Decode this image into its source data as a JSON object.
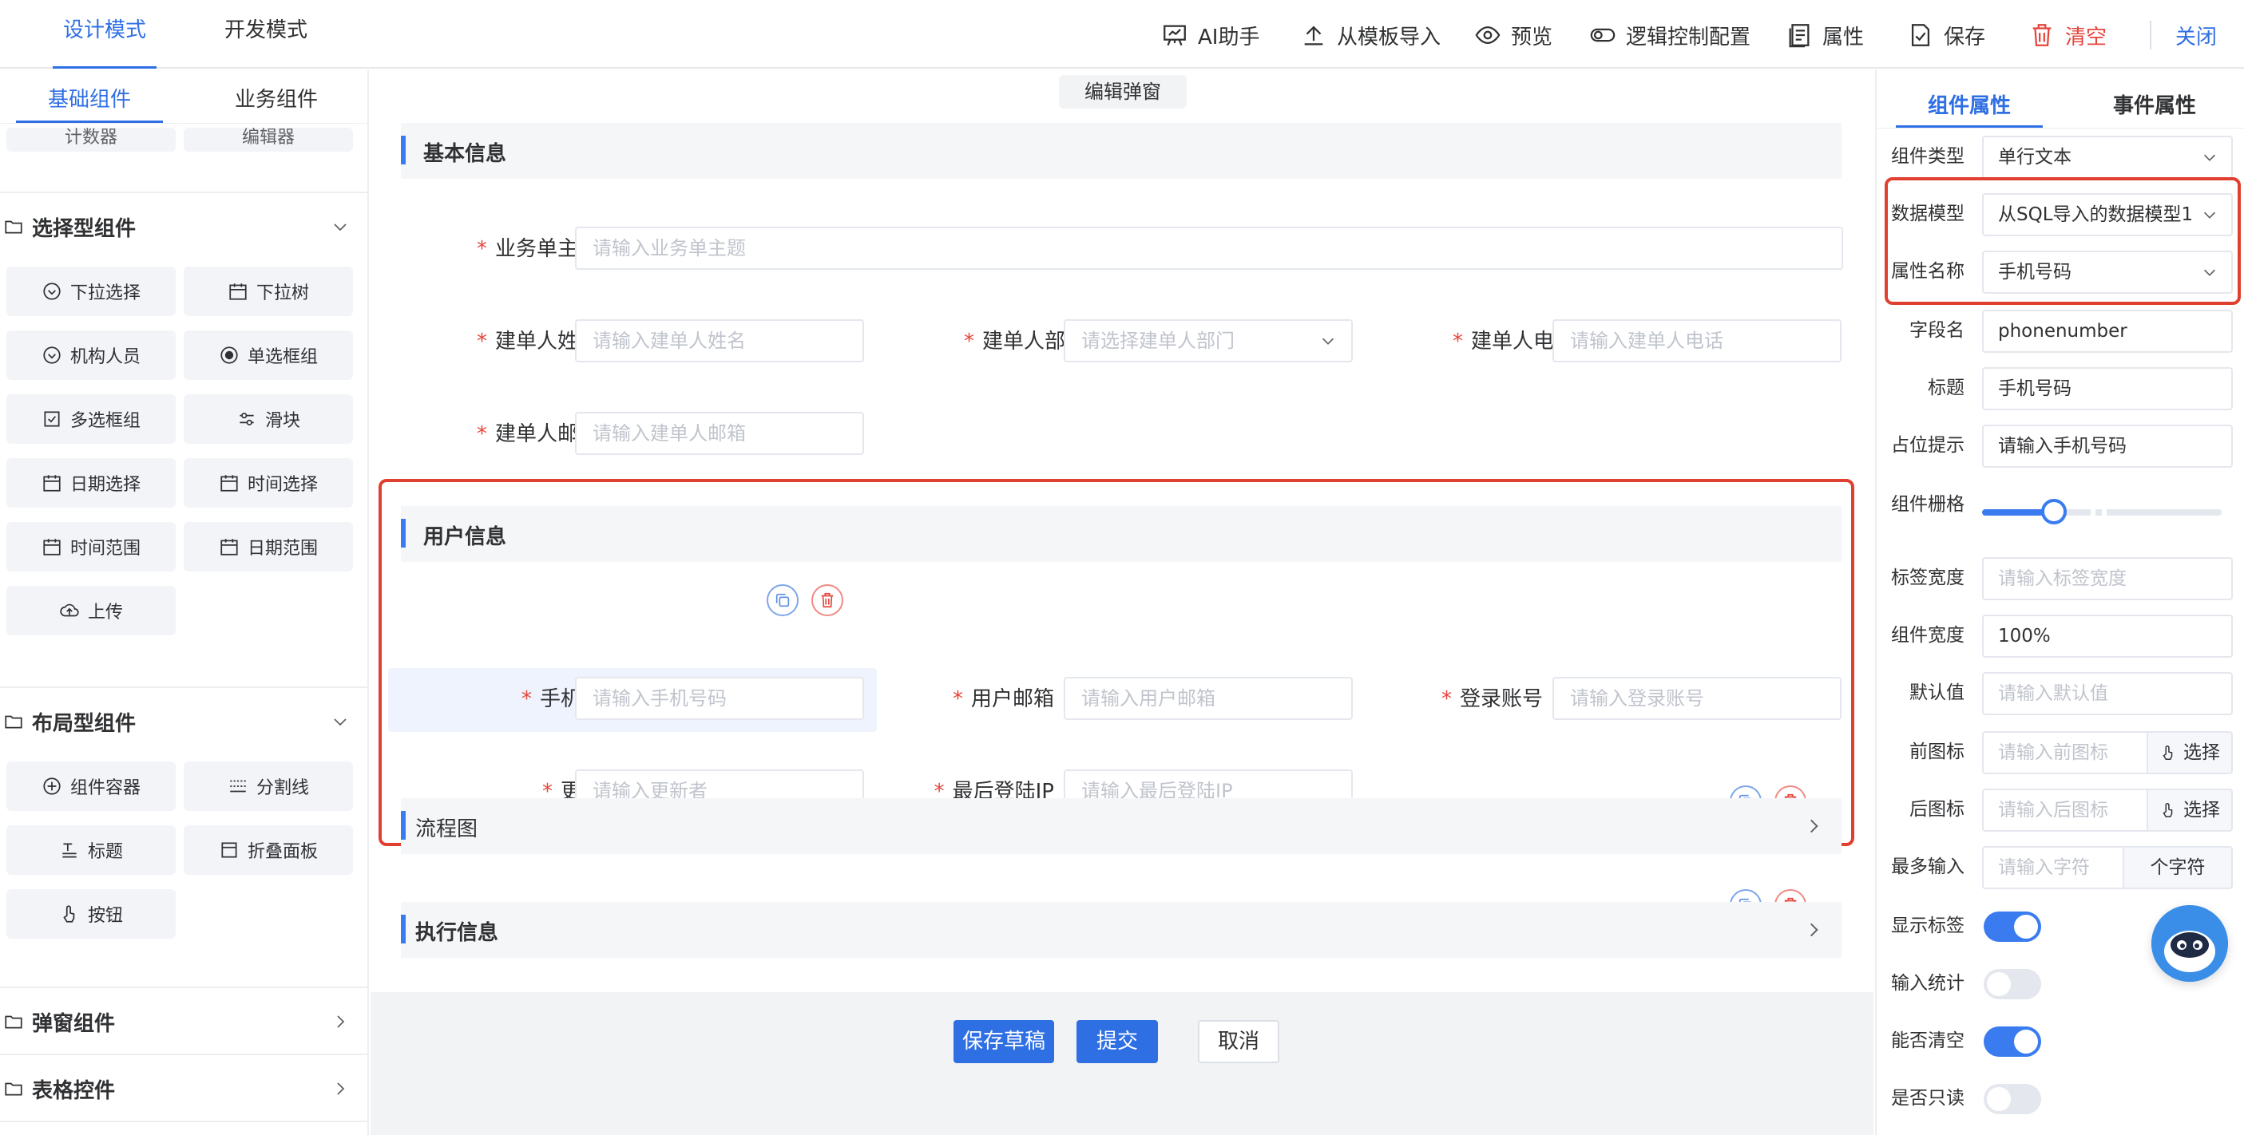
{
  "header": {
    "modes": [
      "设计模式",
      "开发模式"
    ],
    "tools": {
      "ai": "AI助手",
      "import": "从模板导入",
      "preview": "预览",
      "logic": "逻辑控制配置",
      "props": "属性",
      "save": "保存",
      "clear": "清空",
      "close": "关闭"
    }
  },
  "left": {
    "tabs": [
      "基础组件",
      "业务组件"
    ],
    "partial": [
      "计数器",
      "编辑器"
    ],
    "groups": {
      "select": "选择型组件",
      "layout": "布局型组件",
      "popup": "弹窗组件",
      "table": "表格控件"
    },
    "select_items": [
      "下拉选择",
      "下拉树",
      "机构人员",
      "单选框组",
      "多选框组",
      "滑块",
      "日期选择",
      "时间选择",
      "时间范围",
      "日期范围",
      "上传"
    ],
    "layout_items": [
      "组件容器",
      "分割线",
      "标题",
      "折叠面板",
      "按钮"
    ]
  },
  "canvas": {
    "dialog_title": "编辑弹窗",
    "sections": {
      "basic": "基本信息",
      "user": "用户信息",
      "flow": "流程图",
      "exec": "执行信息"
    },
    "basic_fields": {
      "subject": {
        "label": "业务单主题",
        "placeholder": "请输入业务单主题"
      },
      "creator_name": {
        "label": "建单人姓名",
        "placeholder": "请输入建单人姓名"
      },
      "creator_dept": {
        "label": "建单人部门",
        "placeholder": "请选择建单人部门"
      },
      "creator_phone": {
        "label": "建单人电话",
        "placeholder": "请输入建单人电话"
      },
      "creator_email": {
        "label": "建单人邮箱",
        "placeholder": "请输入建单人邮箱"
      }
    },
    "user_fields": {
      "phone": {
        "label": "手机号码",
        "placeholder": "请输入手机号码"
      },
      "email": {
        "label": "用户邮箱",
        "placeholder": "请输入用户邮箱"
      },
      "account": {
        "label": "登录账号",
        "placeholder": "请输入登录账号"
      },
      "updater": {
        "label": "更新者",
        "placeholder": "请输入更新者"
      },
      "last_ip": {
        "label": "最后登陆IP",
        "placeholder": "请输入最后登陆IP"
      }
    },
    "footer": {
      "draft": "保存草稿",
      "submit": "提交",
      "cancel": "取消"
    }
  },
  "right": {
    "tabs": [
      "组件属性",
      "事件属性"
    ],
    "props": {
      "type": {
        "label": "组件类型",
        "value": "单行文本"
      },
      "model": {
        "label": "数据模型",
        "value": "从SQL导入的数据模型1"
      },
      "attr": {
        "label": "属性名称",
        "value": "手机号码"
      },
      "field": {
        "label": "字段名",
        "value": "phonenumber"
      },
      "title": {
        "label": "标题",
        "value": "手机号码"
      },
      "placeholder": {
        "label": "占位提示",
        "value": "请输入手机号码"
      },
      "grid": {
        "label": "组件栅格",
        "value": 0.3
      },
      "label_width": {
        "label": "标签宽度",
        "placeholder": "请输入标签宽度"
      },
      "width": {
        "label": "组件宽度",
        "value": "100%"
      },
      "default": {
        "label": "默认值",
        "placeholder": "请输入默认值"
      },
      "prefix_icon": {
        "label": "前图标",
        "placeholder": "请输入前图标",
        "button": "选择"
      },
      "suffix_icon": {
        "label": "后图标",
        "placeholder": "请输入后图标",
        "button": "选择"
      },
      "max_input": {
        "label": "最多输入",
        "placeholder": "请输入字符",
        "unit": "个字符"
      },
      "show_label": {
        "label": "显示标签",
        "on": true
      },
      "input_count": {
        "label": "输入统计",
        "on": false
      },
      "clearable": {
        "label": "能否清空",
        "on": true
      },
      "readonly": {
        "label": "是否只读",
        "on": false
      }
    }
  },
  "colors": {
    "accent": "#2f6fe4",
    "danger": "#e6453c",
    "highlight": "#e0402f"
  }
}
